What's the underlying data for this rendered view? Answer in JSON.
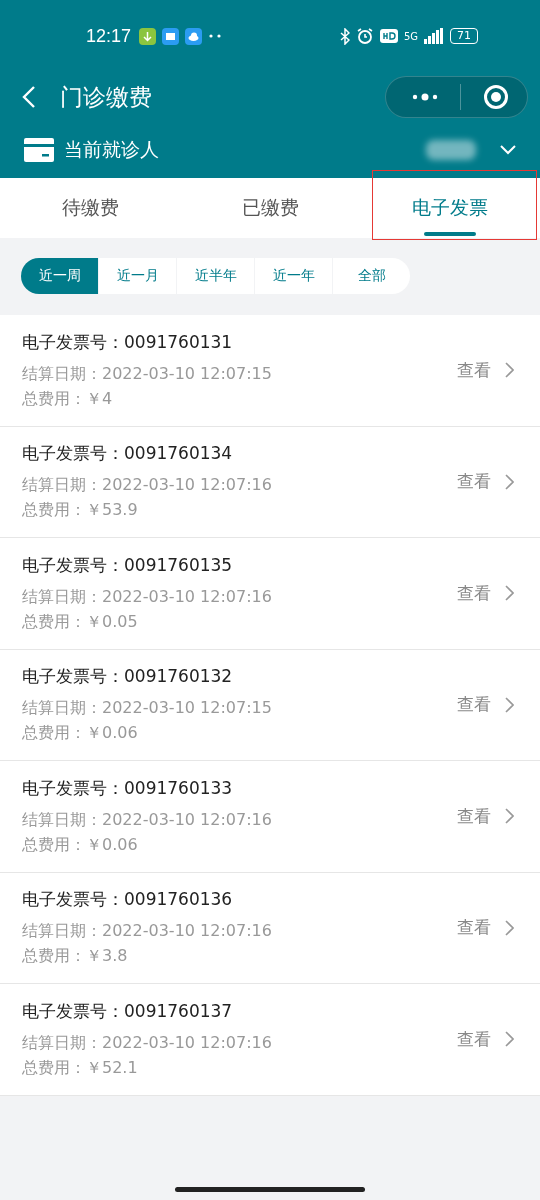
{
  "status_bar": {
    "time": "12:17",
    "network": "5G",
    "battery": "71"
  },
  "nav": {
    "title": "门诊缴费"
  },
  "patient": {
    "label": "当前就诊人"
  },
  "tabs": [
    {
      "label": "待缴费",
      "selected": false
    },
    {
      "label": "已缴费",
      "selected": false
    },
    {
      "label": "电子发票",
      "selected": true
    }
  ],
  "filters": [
    {
      "label": "近一周",
      "selected": true
    },
    {
      "label": "近一月",
      "selected": false
    },
    {
      "label": "近半年",
      "selected": false
    },
    {
      "label": "近一年",
      "selected": false
    },
    {
      "label": "全部",
      "selected": false
    }
  ],
  "invoices": [
    {
      "number": "电子发票号：0091760131",
      "date": "结算日期：2022-03-10 12:07:15",
      "total": "总费用：￥4",
      "action": "查看"
    },
    {
      "number": "电子发票号：0091760134",
      "date": "结算日期：2022-03-10 12:07:16",
      "total": "总费用：￥53.9",
      "action": "查看"
    },
    {
      "number": "电子发票号：0091760135",
      "date": "结算日期：2022-03-10 12:07:16",
      "total": "总费用：￥0.05",
      "action": "查看"
    },
    {
      "number": "电子发票号：0091760132",
      "date": "结算日期：2022-03-10 12:07:15",
      "total": "总费用：￥0.06",
      "action": "查看"
    },
    {
      "number": "电子发票号：0091760133",
      "date": "结算日期：2022-03-10 12:07:16",
      "total": "总费用：￥0.06",
      "action": "查看"
    },
    {
      "number": "电子发票号：0091760136",
      "date": "结算日期：2022-03-10 12:07:16",
      "total": "总费用：￥3.8",
      "action": "查看"
    },
    {
      "number": "电子发票号：0091760137",
      "date": "结算日期：2022-03-10 12:07:16",
      "total": "总费用：￥52.1",
      "action": "查看"
    }
  ]
}
